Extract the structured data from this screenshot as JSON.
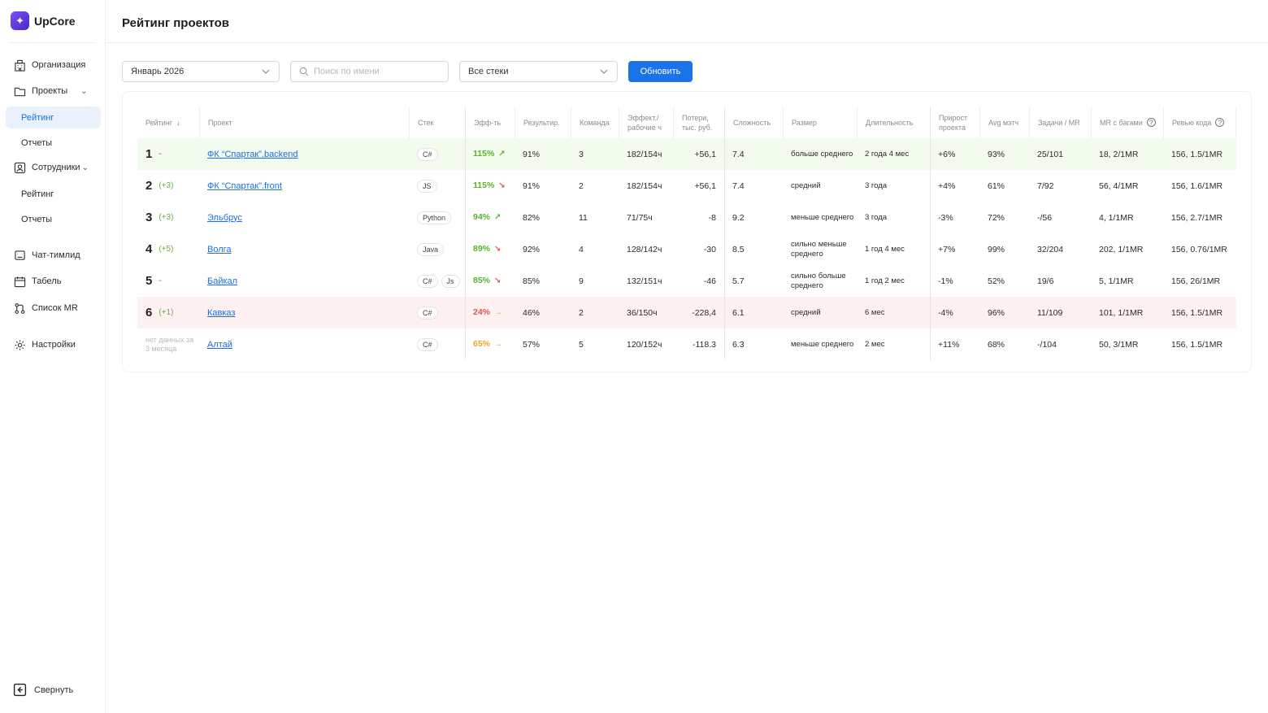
{
  "app": {
    "name": "UpCore"
  },
  "sidebar": {
    "items": [
      {
        "label": "Организация"
      },
      {
        "label": "Проекты"
      },
      {
        "label": "Рейтинг"
      },
      {
        "label": "Отчеты"
      },
      {
        "label": "Сотрудники"
      },
      {
        "label": "Рейтинг"
      },
      {
        "label": "Отчеты"
      },
      {
        "label": "Чат-тимлид"
      },
      {
        "label": "Табель"
      },
      {
        "label": "Список MR"
      },
      {
        "label": "Настройки"
      }
    ],
    "collapse_label": "Свернуть"
  },
  "page": {
    "title": "Рейтинг проектов"
  },
  "filters": {
    "period": "Январь 2026",
    "search_placeholder": "Поиск по имени",
    "stack": "Все стеки",
    "refresh_label": "Обновить"
  },
  "table": {
    "headers": {
      "rank": "Рейтинг",
      "project": "Проект",
      "stack": "Стек",
      "eff": "Эфф-ть",
      "result": "Результир.",
      "team": "Команда",
      "eff_hours_1": "Эффект./",
      "eff_hours_2": "рабочие ч",
      "loss_1": "Потери,",
      "loss_2": "тыс. руб.",
      "complexity": "Сложность",
      "size": "Размер",
      "duration": "Длительность",
      "growth_1": "Прирост",
      "growth_2": "проекта",
      "avg": "Avg мэтч",
      "tasks": "Задачи / MR",
      "mr_bugs": "MR с багами",
      "review": "Ревью кода"
    },
    "rows": [
      {
        "rank": "1",
        "delta": "-",
        "project": "ФК “Спартак”.backend",
        "stack": [
          "C#"
        ],
        "eff": "115%",
        "eff_color": "#56b32b",
        "eff_trend": "up",
        "result": "91%",
        "team": "3",
        "eff_hours": "182/154ч",
        "loss": "+56,1",
        "complexity": "7.4",
        "size": "больше среднего",
        "duration": "2 года 4 мес",
        "growth": "+6%",
        "avg": "93%",
        "tasks": "25/101",
        "mr_bugs": "18, 2/1MR",
        "review": "156, 1.5/1MR",
        "highlight": "good"
      },
      {
        "rank": "2",
        "delta": "(+3)",
        "project": "ФК “Спартак”.front",
        "stack": [
          "JS"
        ],
        "eff": "115%",
        "eff_color": "#56b32b",
        "eff_trend": "down",
        "result": "91%",
        "team": "2",
        "eff_hours": "182/154ч",
        "loss": "+56,1",
        "complexity": "7.4",
        "size": "средний",
        "duration": "3 года",
        "growth": "+4%",
        "avg": "61%",
        "tasks": "7/92",
        "mr_bugs": "56, 4/1MR",
        "review": "156, 1.6/1MR",
        "highlight": ""
      },
      {
        "rank": "3",
        "delta": "(+3)",
        "project": "Эльбрус",
        "stack": [
          "Python"
        ],
        "eff": "94%",
        "eff_color": "#56b32b",
        "eff_trend": "up",
        "result": "82%",
        "team": "11",
        "eff_hours": "71/75ч",
        "loss": "-8",
        "complexity": "9.2",
        "size": "меньше среднего",
        "duration": "3 года",
        "growth": "-3%",
        "avg": "72%",
        "tasks": "-/56",
        "mr_bugs": "4, 1/1MR",
        "review": "156, 2.7/1MR",
        "highlight": ""
      },
      {
        "rank": "4",
        "delta": "(+5)",
        "project": "Волга",
        "stack": [
          "Java"
        ],
        "eff": "89%",
        "eff_color": "#56b32b",
        "eff_trend": "down",
        "result": "92%",
        "team": "4",
        "eff_hours": "128/142ч",
        "loss": "-30",
        "complexity": "8.5",
        "size": "сильно меньше среднего",
        "duration": "1 год 4 мес",
        "growth": "+7%",
        "avg": "99%",
        "tasks": "32/204",
        "mr_bugs": "202, 1/1MR",
        "review": "156, 0.76/1MR",
        "highlight": ""
      },
      {
        "rank": "5",
        "delta": "-",
        "project": "Байкал",
        "stack": [
          "C#",
          "Js"
        ],
        "eff": "85%",
        "eff_color": "#56b32b",
        "eff_trend": "down",
        "result": "85%",
        "team": "9",
        "eff_hours": "132/151ч",
        "loss": "-46",
        "complexity": "5.7",
        "size": "сильно больше среднего",
        "duration": "1 год 2 мес",
        "growth": "-1%",
        "avg": "52%",
        "tasks": "19/6",
        "mr_bugs": "5, 1/1MR",
        "review": "156, 26/1MR",
        "highlight": ""
      },
      {
        "rank": "6",
        "delta": "(+1)",
        "project": "Кавказ",
        "stack": [
          "C#"
        ],
        "eff": "24%",
        "eff_color": "#e35454",
        "eff_trend": "flat",
        "result": "46%",
        "team": "2",
        "eff_hours": "36/150ч",
        "loss": "-228,4",
        "complexity": "6.1",
        "size": "средний",
        "duration": "6 мес",
        "growth": "-4%",
        "avg": "96%",
        "tasks": "11/109",
        "mr_bugs": "101, 1/1MR",
        "review": "156, 1.5/1MR",
        "highlight": "bad"
      },
      {
        "rank": "",
        "delta": "",
        "no_data": "нет данных за 3 месяца",
        "project": "Алтай",
        "stack": [
          "C#"
        ],
        "eff": "65%",
        "eff_color": "#eda62a",
        "eff_trend": "flat",
        "result": "57%",
        "team": "5",
        "eff_hours": "120/152ч",
        "loss": "-118.3",
        "complexity": "6.3",
        "size": "меньше среднего",
        "duration": "2 мес",
        "growth": "+11%",
        "avg": "68%",
        "tasks": "-/104",
        "mr_bugs": "50, 3/1MR",
        "review": "156, 1.5/1MR",
        "highlight": ""
      }
    ]
  },
  "colors": {
    "accent": "#1a73e8",
    "link": "#1a6fe6",
    "good_row": "#f3fbee",
    "bad_row": "#fdf1f1",
    "up": "#56b32b",
    "down": "#e35454",
    "flat": "#eda62a"
  }
}
